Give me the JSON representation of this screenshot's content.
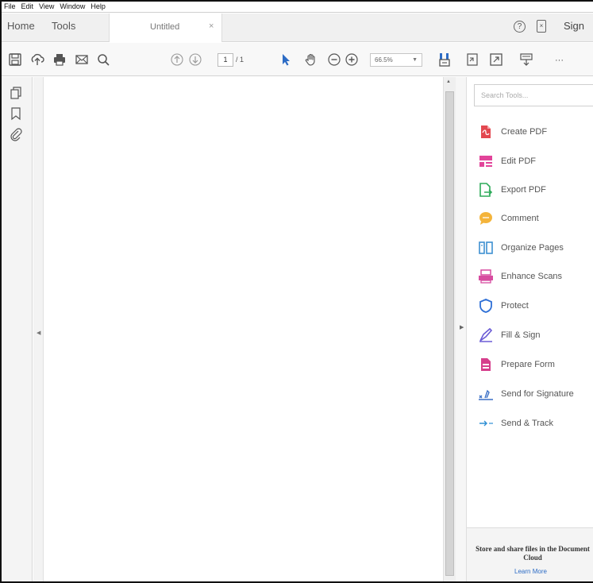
{
  "menu": [
    "File",
    "Edit",
    "View",
    "Window",
    "Help"
  ],
  "tabs": {
    "home": "Home",
    "tools": "Tools",
    "document": "Untitled",
    "close": "×"
  },
  "header": {
    "help": "?",
    "sign": "Sign"
  },
  "toolbar": {
    "page_current": "1",
    "page_total": "/ 1",
    "zoom": "66.5%",
    "zoom_arrow": "▼",
    "more": "···"
  },
  "search": {
    "placeholder": "Search Tools..."
  },
  "tools": [
    {
      "label": "Create PDF",
      "icon": "create-pdf-icon",
      "color": "#e34850"
    },
    {
      "label": "Edit PDF",
      "icon": "edit-pdf-icon",
      "color": "#e2449a"
    },
    {
      "label": "Export PDF",
      "icon": "export-pdf-icon",
      "color": "#2eab5a"
    },
    {
      "label": "Comment",
      "icon": "comment-icon",
      "color": "#f4b43b"
    },
    {
      "label": "Organize Pages",
      "icon": "organize-pages-icon",
      "color": "#3d8fd1"
    },
    {
      "label": "Enhance Scans",
      "icon": "enhance-scans-icon",
      "color": "#d74ca0"
    },
    {
      "label": "Protect",
      "icon": "protect-icon",
      "color": "#2e6fd6"
    },
    {
      "label": "Fill & Sign",
      "icon": "fill-sign-icon",
      "color": "#6a5bd5"
    },
    {
      "label": "Prepare Form",
      "icon": "prepare-form-icon",
      "color": "#d63e8c"
    },
    {
      "label": "Send for Signature",
      "icon": "send-signature-icon",
      "color": "#3a6fc6"
    },
    {
      "label": "Send & Track",
      "icon": "send-track-icon",
      "color": "#2f8fd4"
    }
  ],
  "cloud": {
    "text": "Store and share files in the Document Cloud",
    "link": "Learn More"
  },
  "colors": {
    "accent_blue": "#2d6cc5",
    "panel_bg": "#f4f4f4"
  }
}
